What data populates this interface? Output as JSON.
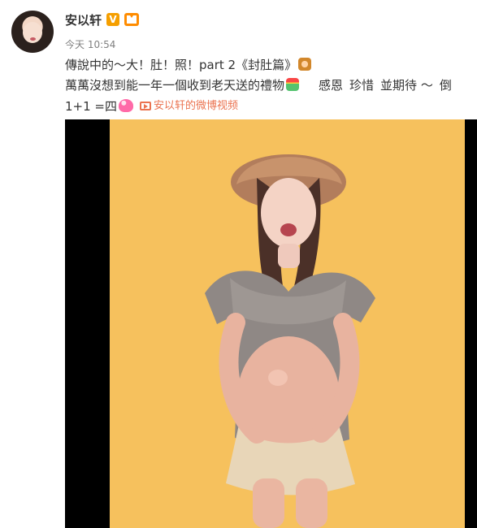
{
  "user": {
    "name": "安以轩",
    "verified_badge": "V"
  },
  "post": {
    "timestamp": "今天 10:54",
    "lines": {
      "line1": "傳說中的～大！肚！照！part 2《封肚篇》",
      "line2_main": "萬萬沒想到能一年一個收到老天送的禮物",
      "line2_tags": [
        "感恩",
        "珍惜",
        "並期待 ～",
        "倒"
      ],
      "line3_main": "1+1 =四",
      "video_label": "安以轩的微博视频"
    }
  },
  "media": {
    "kind": "video-thumbnail"
  },
  "colors": {
    "accent": "#eb7350",
    "photo_background": "#f6c15d",
    "verified": "#f59f00"
  },
  "icons": {
    "verified": "verified-badge-icon",
    "member": "member-icon",
    "video": "video-icon"
  }
}
